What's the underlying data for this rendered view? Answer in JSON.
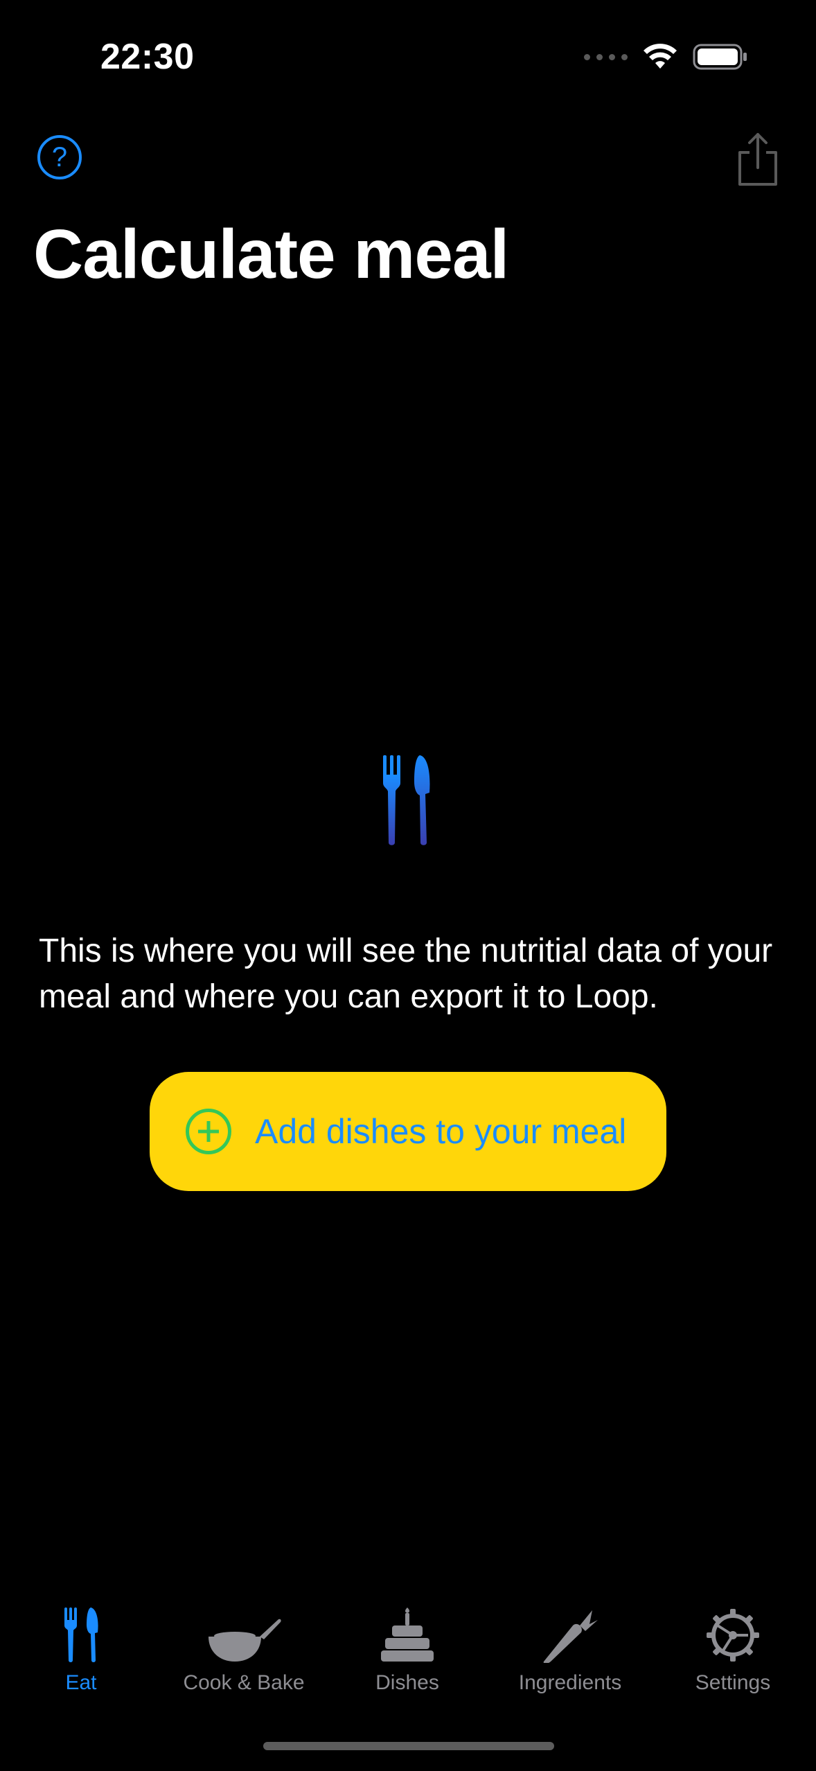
{
  "status_bar": {
    "time": "22:30"
  },
  "nav": {
    "help_icon": "question-circle-icon",
    "share_icon": "share-icon"
  },
  "page_title": "Calculate meal",
  "empty_state": {
    "icon": "fork-knife-icon",
    "message": "This is where you will see the nutritial data of your meal and where you can export it to Loop.",
    "add_button_label": "Add dishes to your meal",
    "add_button_icon": "plus-circle-icon"
  },
  "tab_bar": {
    "tabs": [
      {
        "label": "Eat",
        "icon": "fork-knife-icon",
        "active": true
      },
      {
        "label": "Cook & Bake",
        "icon": "frying-pan-icon",
        "active": false
      },
      {
        "label": "Dishes",
        "icon": "birthday-cake-icon",
        "active": false
      },
      {
        "label": "Ingredients",
        "icon": "carrot-icon",
        "active": false
      },
      {
        "label": "Settings",
        "icon": "gear-icon",
        "active": false
      }
    ]
  },
  "colors": {
    "background": "#000000",
    "accent_blue": "#1a8cff",
    "button_yellow": "#ffd60a",
    "plus_green": "#34c759",
    "inactive_gray": "#8e8e93"
  }
}
